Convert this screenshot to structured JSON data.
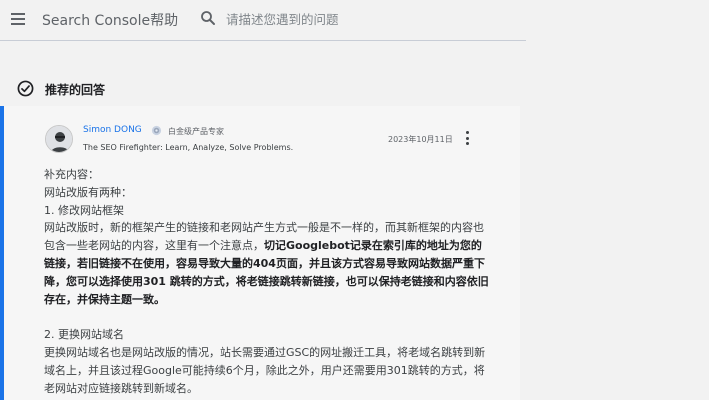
{
  "header": {
    "menu_icon": "hamburger-menu-icon",
    "brand_title": "Search Console帮助",
    "search_icon": "search-icon",
    "search_placeholder": "请描述您遇到的问题"
  },
  "recommended": {
    "check_icon": "check-circle-icon",
    "title": "推荐的回答"
  },
  "reply": {
    "author_name": "Simon DONG",
    "badge_icon": "platinum-badge-icon",
    "badge_label": "白金级产品专家",
    "tagline": "The SEO Firefighter: Learn, Analyze, Solve Problems.",
    "date": "2023年10月11日",
    "more_icon": "more-vert-icon",
    "body": {
      "line1": "补充内容：",
      "line2": "网站改版有两种：",
      "line3": "1. 修改网站框架",
      "p1_normal": "网站改版时，新的框架产生的链接和老网站产生方式一般是不一样的，而其新框架的内容也包含一些老网站的内容，这里有一个注意点，",
      "p1_bold": "切记Googlebot记录在索引库的地址为您的链接，若旧链接不在使用，容易导致大量的404页面，并且该方式容易导致网站数据严重下降，您可以选择使用301 跳转的方式，将老链接跳转新链接，也可以保持老链接和内容依旧存在，并保持主题一致。",
      "line5": "2. 更换网站域名",
      "p2": "更换网站域名也是网站改版的情况，站长需要通过GSC的网址搬迁工具，将老域名跳转到新域名上，并且该过程Google可能持续6个月，除此之外，用户还需要用301跳转的方式，将老网站对应链接跳转到新域名。"
    }
  },
  "colors": {
    "accent": "#1a73e8",
    "background": "#f2f2f2"
  }
}
